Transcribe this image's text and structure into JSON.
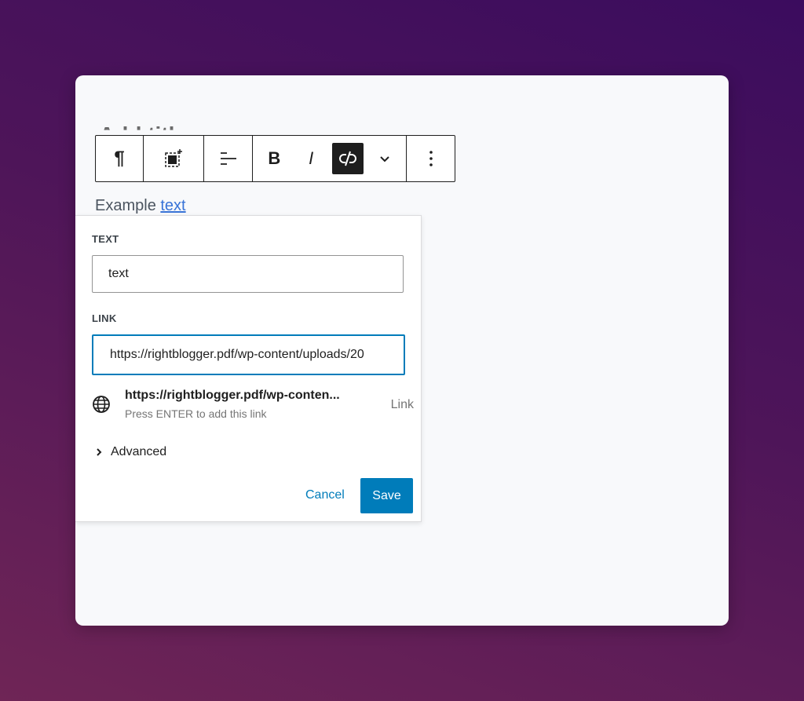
{
  "editor": {
    "heading_partial": "Add title",
    "paragraph": {
      "prefix": "Example ",
      "link_text": "text"
    }
  },
  "toolbar": {
    "items": [
      {
        "name": "paragraph",
        "icon": "pilcrow-icon",
        "glyph": "¶"
      },
      {
        "name": "block-transform",
        "icon": "block-add-icon"
      },
      {
        "name": "align",
        "icon": "align-left-icon"
      },
      {
        "name": "bold",
        "icon": "bold-icon",
        "glyph": "B"
      },
      {
        "name": "italic",
        "icon": "italic-icon",
        "glyph": "I"
      },
      {
        "name": "unlink",
        "icon": "unlink-icon",
        "active": true
      },
      {
        "name": "more-rich-text",
        "icon": "chevron-down-icon"
      },
      {
        "name": "options",
        "icon": "more-vertical-icon"
      }
    ]
  },
  "link_popover": {
    "text_label": "TEXT",
    "text_value": "text",
    "link_label": "LINK",
    "link_value": "https://rightblogger.pdf/wp-content/uploads/20",
    "suggestion": {
      "icon": "globe-icon",
      "title": "https://rightblogger.pdf/wp-conten...",
      "subtitle": "Press ENTER to add this link",
      "type": "Link"
    },
    "advanced_label": "Advanced",
    "cancel_label": "Cancel",
    "save_label": "Save"
  },
  "colors": {
    "accent": "#007cba",
    "link": "#3873d7",
    "dark": "#1e1e1e"
  }
}
